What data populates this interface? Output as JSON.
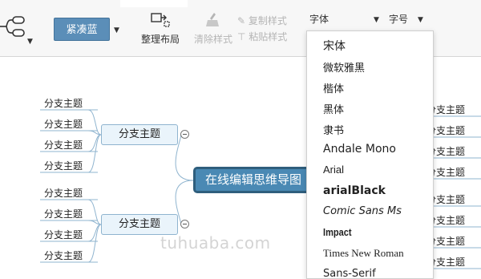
{
  "toolbar": {
    "theme_button_label": "紧凑蓝",
    "arrange_label": "整理布局",
    "clear_style_label": "清除样式",
    "copy_style_label": "复制样式",
    "paste_style_label": "粘贴样式",
    "font_family_label": "字体",
    "font_size_label": "字号"
  },
  "font_dropdown": {
    "items": [
      "宋体",
      "微软雅黑",
      "楷体",
      "黑体",
      "隶书",
      "Andale Mono",
      "Arial",
      "arialBlack",
      "Comic Sans Ms",
      "Impact",
      "Times New Roman",
      "Sans-Serif"
    ]
  },
  "mindmap": {
    "root_label": "在线编辑思维导图",
    "left_branches": [
      {
        "label": "分支主题",
        "leaves": [
          "分支主题",
          "分支主题",
          "分支主题",
          "分支主题"
        ]
      },
      {
        "label": "分支主题",
        "leaves": [
          "分支主题",
          "分支主题",
          "分支主题",
          "分支主题"
        ]
      }
    ],
    "right_leaves": [
      "分支主题",
      "分支主题",
      "分支主题",
      "分支主题",
      "分支主题",
      "分支主题",
      "分支主题",
      "分支主题"
    ]
  },
  "watermark": "tuhuaba.com",
  "colors": {
    "theme_button": "#5b8eb8",
    "root_fill": "#4a89b4",
    "root_border": "#2f5e7d",
    "branch_fill": "#eaf4fb",
    "connector": "#8fb4cf"
  }
}
